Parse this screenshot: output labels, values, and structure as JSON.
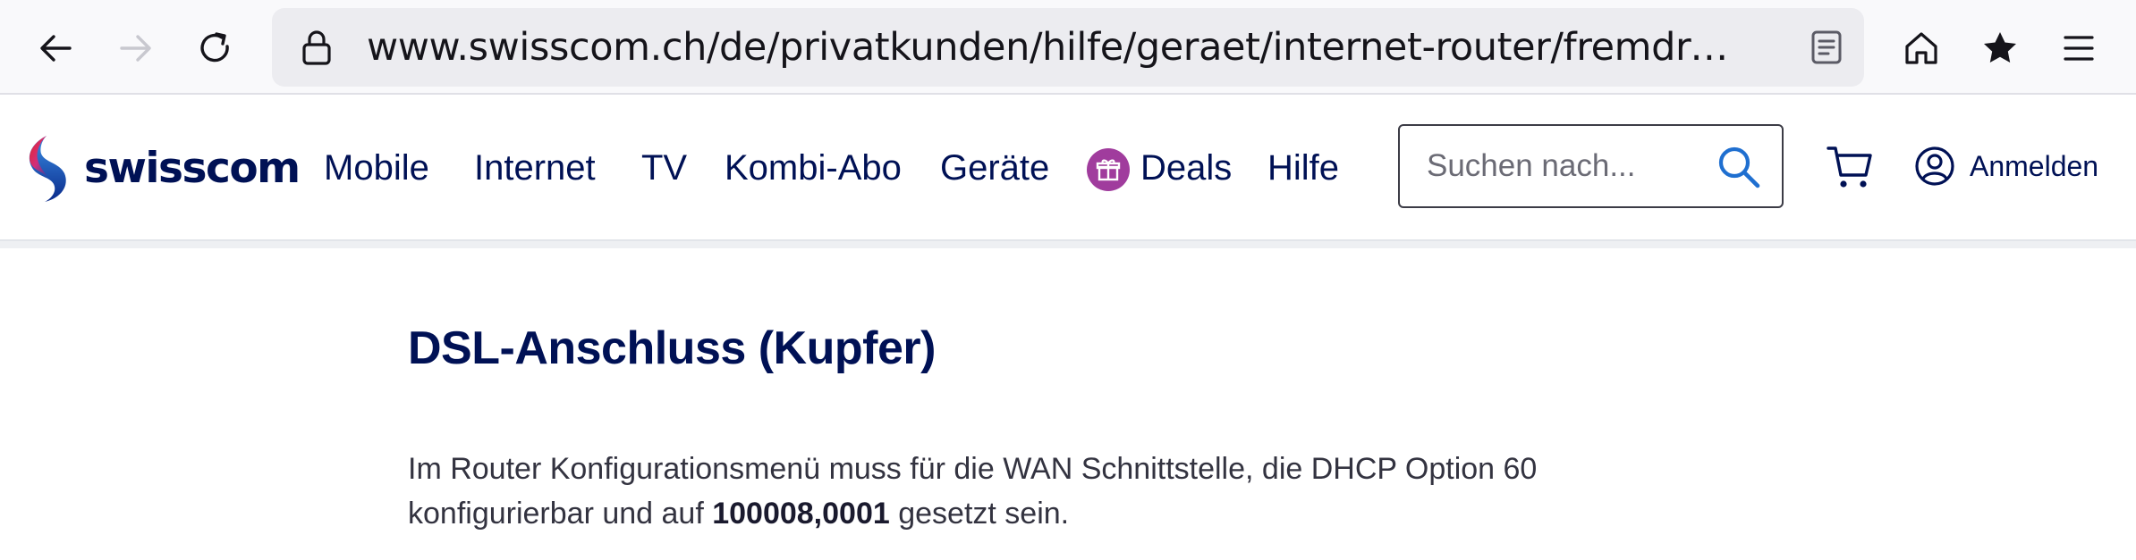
{
  "browser": {
    "url": "www.swisscom.ch/de/privatkunden/hilfe/geraet/internet-router/fremdrouter.ht…",
    "icons": [
      "back-icon",
      "forward-icon",
      "reload-icon",
      "lock-icon",
      "reader-view-icon",
      "home-icon",
      "bookmark-star-icon",
      "menu-icon"
    ]
  },
  "header": {
    "logo_text": "swisscom",
    "nav": [
      {
        "label": "Mobile"
      },
      {
        "label": "Internet"
      },
      {
        "label": "TV"
      },
      {
        "label": "Kombi-Abo"
      },
      {
        "label": "Geräte"
      },
      {
        "label": "Deals"
      },
      {
        "label": "Hilfe"
      }
    ],
    "search_placeholder": "Suchen nach...",
    "login_label": "Anmelden"
  },
  "content": {
    "title": "DSL-Anschluss (Kupfer)",
    "paragraph_part1": "Im Router Konfigurationsmenü muss für die WAN Schnittstelle, die DHCP Option 60 konfigurierbar und auf ",
    "paragraph_bold": "100008,0001",
    "paragraph_part2": " gesetzt sein."
  },
  "colors": {
    "brand_navy": "#001155",
    "deals_purple": "#a03c9d",
    "search_blue": "#1f6fd0"
  }
}
